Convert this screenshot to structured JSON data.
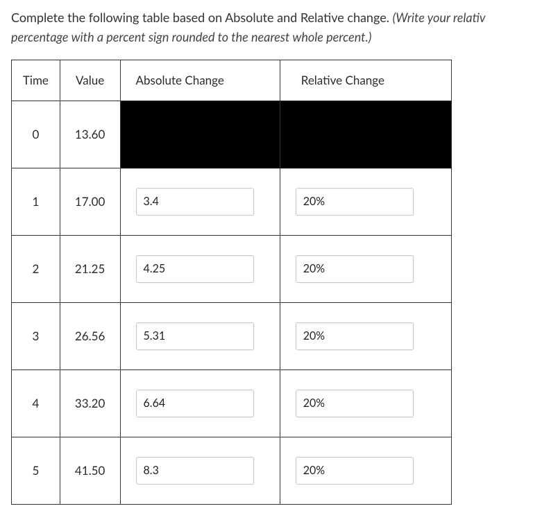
{
  "prompt": {
    "main": "Complete the following table based on Absolute and Relative change. ",
    "italic": "(Write your relativ percentage with a percent sign rounded to the nearest whole percent.)"
  },
  "headers": {
    "time": "Time",
    "value": "Value",
    "absolute": "Absolute Change",
    "relative": "Relative Change"
  },
  "rows": [
    {
      "time": "0",
      "value": "13.60",
      "absolute": null,
      "relative": null
    },
    {
      "time": "1",
      "value": "17.00",
      "absolute": "3.4",
      "relative": "20%"
    },
    {
      "time": "2",
      "value": "21.25",
      "absolute": "4.25",
      "relative": "20%"
    },
    {
      "time": "3",
      "value": "26.56",
      "absolute": "5.31",
      "relative": "20%"
    },
    {
      "time": "4",
      "value": "33.20",
      "absolute": "6.64",
      "relative": "20%"
    },
    {
      "time": "5",
      "value": "41.50",
      "absolute": "8.3",
      "relative": "20%"
    }
  ]
}
